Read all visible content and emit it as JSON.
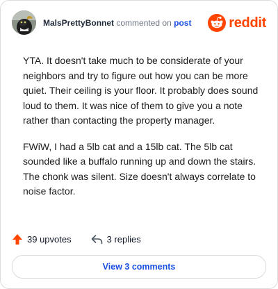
{
  "comment": {
    "username": "MalsPrettyBonnet",
    "action_text": "commented on",
    "post_link": "post",
    "paragraphs": [
      "YTA. It doesn't take much to be considerate of your neighbors and try to figure out how you can be more quiet. Their ceiling is your floor. It probably does sound loud to them. It was nice of them to give you a note rather than contacting the property manager.",
      "FWiW, I had a 5lb cat and a 15lb cat. The 5lb cat sounded like a buffalo running up and down the stairs. The chonk was silent. Size doesn't always correlate to noise factor."
    ]
  },
  "brand": {
    "wordmark": "reddit",
    "color": "#ff4500"
  },
  "actions": {
    "upvotes_label": "39 upvotes",
    "replies_label": "3 replies"
  },
  "view_comments_label": "View 3 comments",
  "icons": {
    "upvote": "upvote-arrow-icon",
    "reply": "reply-arrow-icon",
    "logo": "reddit-alien-icon"
  },
  "colors": {
    "link": "#1a4ee0",
    "upvote": "#ff4500"
  }
}
